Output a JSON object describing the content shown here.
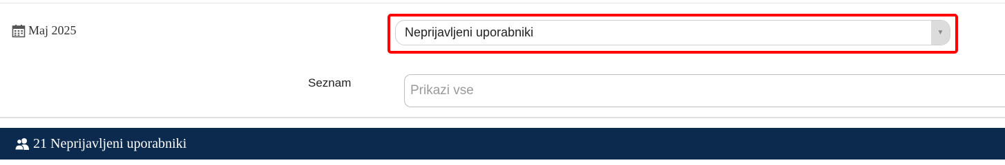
{
  "filter_panel": {
    "month_label": "Maj 2025",
    "month_icon": "calendar-icon",
    "user_status_select": {
      "value": "Neprijavljeni uporabniki",
      "arrow_icon": "triangle-down-icon",
      "highlight_color": "#ff0000"
    },
    "list_field": {
      "label": "Seznam",
      "placeholder": "Prikazi vse"
    }
  },
  "results_banner": {
    "icon": "users-icon",
    "count": "21",
    "title": "Neprijavljeni uporabniki",
    "background_color": "#0b2a4e"
  }
}
